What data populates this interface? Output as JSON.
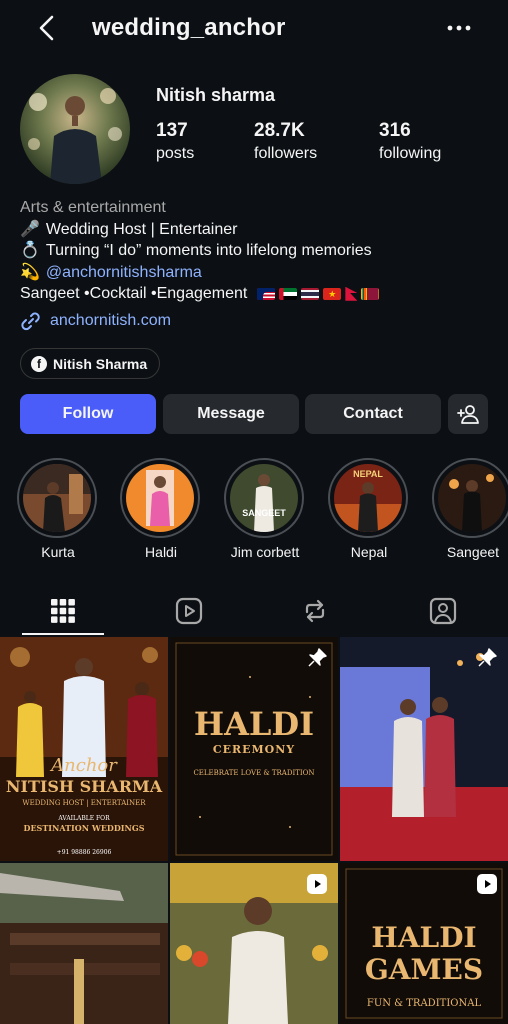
{
  "header": {
    "username": "wedding_anchor",
    "back_icon": "chevron-left-icon",
    "more_icon": "ellipsis-icon"
  },
  "profile": {
    "display_name": "Nitish sharma",
    "stats": [
      {
        "value": "137",
        "label": "posts"
      },
      {
        "value": "28.7K",
        "label": "followers"
      },
      {
        "value": "316",
        "label": "following"
      }
    ]
  },
  "bio": {
    "category": "Arts & entertainment",
    "line1": "Wedding Host | Entertainer",
    "line2": "Turning “I do” moments into lifelong memories",
    "mention": "@anchornitishsharma",
    "line4": "Sangeet •Cocktail •Engagement",
    "link": "anchornitish.com"
  },
  "facebook_chip": {
    "label": "Nitish Sharma"
  },
  "actions": {
    "follow": "Follow",
    "message": "Message",
    "contact": "Contact"
  },
  "highlights": [
    {
      "label": "Kurta"
    },
    {
      "label": "Haldi"
    },
    {
      "label": "Jim corbett",
      "cover_text": "SANGEET"
    },
    {
      "label": "Nepal",
      "cover_text": "NEPAL"
    },
    {
      "label": "Sangeet"
    }
  ],
  "grid": {
    "post1": {
      "anchor": "Anchor",
      "name": "NITISH SHARMA",
      "subtitle": "WEDDING HOST | ENTERTAINER",
      "available": "AVAILABLE FOR",
      "destination": "DESTINATION WEDDINGS",
      "phone": "+91 98886 26906"
    },
    "post2": {
      "title": "HALDI",
      "subtitle": "CEREMONY",
      "tagline": "CELEBRATE LOVE & TRADITION"
    },
    "post6": {
      "title1": "HALDI",
      "title2": "GAMES",
      "tagline": "FUN & TRADITIONAL"
    }
  },
  "colors": {
    "accent": "#4a5df9",
    "link": "#8fb2ff",
    "background": "#0c1014",
    "button": "#262a2f",
    "gold": "#e9b770"
  }
}
